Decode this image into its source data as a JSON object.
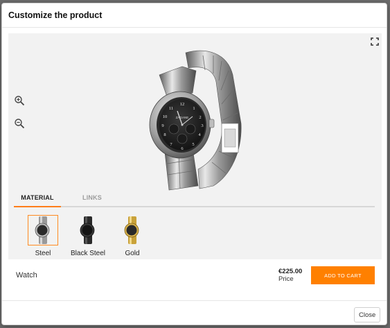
{
  "modal": {
    "title": "Customize the product"
  },
  "viewer": {
    "icons": {
      "fullscreen": "fullscreen-icon",
      "zoom_in": "zoom-in-icon",
      "zoom_out": "zoom-out-icon"
    },
    "watch_brand": "ZAGANE"
  },
  "tabs": [
    {
      "label": "MATERIAL",
      "active": true
    },
    {
      "label": "LINKS",
      "active": false
    }
  ],
  "swatches": [
    {
      "label": "Steel",
      "selected": true,
      "color": "#8a8a8a"
    },
    {
      "label": "Black Steel",
      "selected": false,
      "color": "#2a2a2a"
    },
    {
      "label": "Gold",
      "selected": false,
      "color": "#c9a23a"
    }
  ],
  "product": {
    "name": "Watch",
    "price": "€225.00",
    "price_label": "Price",
    "add_to_cart_label": "ADD TO CART"
  },
  "footer": {
    "close_label": "Close"
  },
  "colors": {
    "accent": "#ff8000",
    "viewer_bg": "#f2f2f2"
  }
}
